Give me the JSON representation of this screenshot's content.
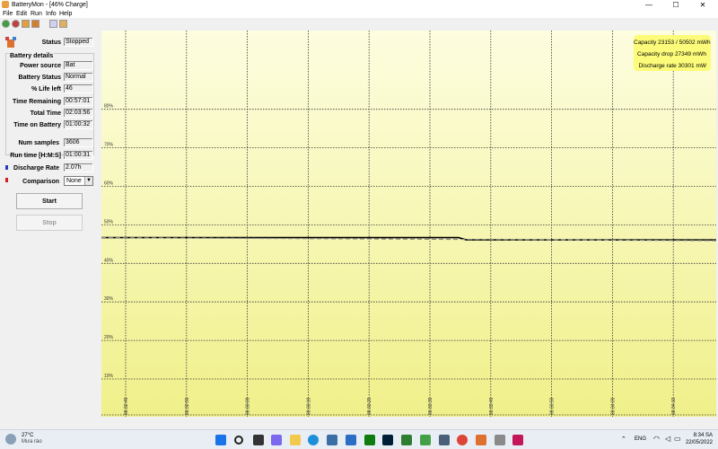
{
  "window": {
    "title": "BatteryMon - [46% Charge]",
    "minimize_glyph": "—",
    "maximize_glyph": "☐",
    "close_glyph": "✕"
  },
  "menu": [
    "File",
    "Edit",
    "Run",
    "Info",
    "Help"
  ],
  "toolbar": [
    "play-icon",
    "record-icon",
    "battery-icon",
    "battery-charge-icon",
    "info-icon",
    "help-icon"
  ],
  "status": {
    "label": "Status",
    "value": "Stopped"
  },
  "battery_details": {
    "title": "Battery details",
    "rows": [
      {
        "label": "Power source",
        "value": "Bat"
      },
      {
        "label": "Battery Status",
        "value": "Normal"
      },
      {
        "label": "% Life left",
        "value": "46"
      },
      {
        "label": "Time Remaining",
        "value": "00:57:01"
      },
      {
        "label": "Total Time",
        "value": "02:03:56"
      },
      {
        "label": "Time on Battery",
        "value": "01:00:32"
      }
    ]
  },
  "stats": {
    "rows": [
      {
        "label": "Num samples",
        "value": "3606"
      },
      {
        "label": "Run time [H:M:S]",
        "value": "01:00:31"
      },
      {
        "label": "Discharge Rate",
        "value": "2.07h"
      }
    ],
    "comparison_label": "Comparison",
    "comparison_value": "None"
  },
  "buttons": {
    "start": "Start",
    "stop": "Stop"
  },
  "colors": {
    "chart_top": "#fdfde0",
    "chart_bottom": "#f0f08a",
    "info_box": "#fcfc7a",
    "discharge_marker": "#2040c0",
    "comparison_marker": "#d02020"
  },
  "info_box": [
    "Capacity 23153 / 50502 mWh",
    "Capacity drop 27349 mWh",
    "Discharge rate 30301 mW"
  ],
  "chart_data": {
    "type": "line",
    "y_tick_labels": [
      "80%",
      "70%",
      "60%",
      "50%",
      "40%",
      "30%",
      "20%",
      "10%"
    ],
    "y_ticks": [
      80,
      70,
      60,
      50,
      40,
      30,
      20,
      10
    ],
    "ylim": [
      0,
      90
    ],
    "x_tick_labels": [
      "08:32:49",
      "08:32:59",
      "08:33:09",
      "08:33:19",
      "08:33:29",
      "08:33:39",
      "08:33:49",
      "08:33:59",
      "08:34:09",
      "08:34:19"
    ],
    "grid": true,
    "series": [
      {
        "style": "solid",
        "x": [
          0,
          5.47,
          5.6,
          9.8
        ],
        "y": [
          46.7,
          46.7,
          46.1,
          46.1
        ]
      },
      {
        "style": "dashed",
        "x": [
          0,
          9.8
        ],
        "y": [
          46.7,
          45.9
        ]
      }
    ]
  },
  "taskbar": {
    "weather_temp": "27°C",
    "weather_desc": "Mưa rào",
    "language": "ENG",
    "time": "8:34 SA",
    "date": "22/05/2022"
  }
}
